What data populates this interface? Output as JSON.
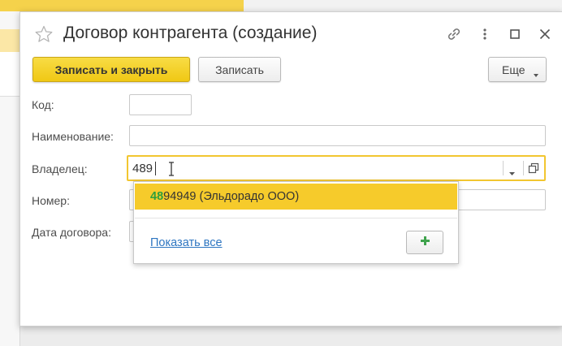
{
  "dialog": {
    "title": "Договор контрагента (создание)"
  },
  "toolbar": {
    "save_close_label": "Записать и закрыть",
    "save_label": "Записать",
    "more_label": "Еще"
  },
  "form": {
    "code_label": "Код:",
    "code_value": "",
    "name_label": "Наименование:",
    "name_value": "",
    "owner_label": "Владелец:",
    "owner_value": "489",
    "number_label": "Номер:",
    "number_value": "",
    "date_label": "Дата договора:",
    "date_value": ""
  },
  "autocomplete": {
    "item_match": "48",
    "item_rest": "94949 (Эльдорадо ООО)",
    "show_all_label": "Показать все"
  },
  "colors": {
    "accent_yellow": "#f2c630",
    "primary_button": "#f0c814",
    "match_highlight": "#2c9f3d",
    "link": "#2e76c1",
    "add_icon": "#3fa34d"
  },
  "icons": [
    "star-icon",
    "link-icon",
    "more-vertical-icon",
    "maximize-icon",
    "close-icon",
    "chevron-down-icon",
    "open-form-icon",
    "plus-icon",
    "text-cursor-icon"
  ]
}
